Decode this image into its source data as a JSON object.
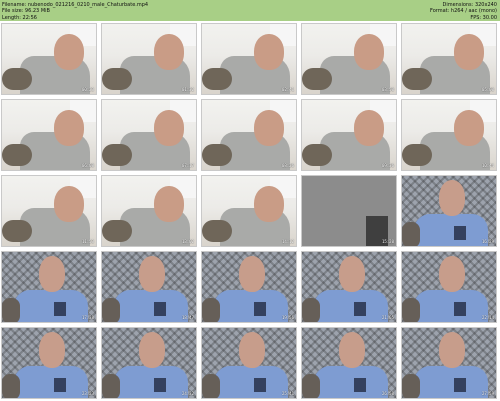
{
  "header": {
    "filename": "Filename: nubenodo_021216_0210_male_Chaturbate.mp4",
    "filesize": "File size: 96.23 MiB",
    "length": "Length: 22:56",
    "dimensions": "Dimensions: 320x240",
    "format": "Format: h264 / aac (mono)",
    "fps": "FPS: 30.00",
    "colors": {
      "bar": "#a8cf86"
    }
  },
  "thumbnails": [
    {
      "scene": "room",
      "time": "00:23"
    },
    {
      "scene": "room",
      "time": "01:32"
    },
    {
      "scene": "room",
      "time": "02:41"
    },
    {
      "scene": "room",
      "time": "03:50"
    },
    {
      "scene": "room",
      "time": "05:00"
    },
    {
      "scene": "room",
      "time": "06:08"
    },
    {
      "scene": "room",
      "time": "07:17"
    },
    {
      "scene": "room",
      "time": "08:26"
    },
    {
      "scene": "room",
      "time": "09:36"
    },
    {
      "scene": "room",
      "time": "10:44"
    },
    {
      "scene": "room",
      "time": "11:53"
    },
    {
      "scene": "room",
      "time": "13:02"
    },
    {
      "scene": "room",
      "time": "14:12"
    },
    {
      "scene": "shirtclose",
      "time": "15:20"
    },
    {
      "scene": "window",
      "time": "16:29"
    },
    {
      "scene": "window",
      "time": "17:38"
    },
    {
      "scene": "window",
      "time": "18:47"
    },
    {
      "scene": "window",
      "time": "19:56"
    },
    {
      "scene": "window",
      "time": "21:05"
    },
    {
      "scene": "window",
      "time": "22:14"
    },
    {
      "scene": "window",
      "time": "23:23"
    },
    {
      "scene": "window",
      "time": "24:32"
    },
    {
      "scene": "window",
      "time": "25:41"
    },
    {
      "scene": "window",
      "time": "26:50"
    },
    {
      "scene": "window",
      "time": "27:59"
    }
  ]
}
